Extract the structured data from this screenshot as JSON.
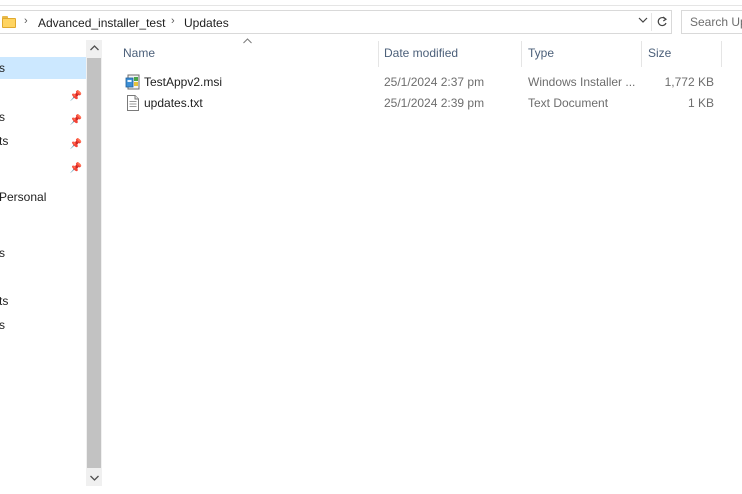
{
  "address": {
    "breadcrumbs": [
      "Advanced_installer_test",
      "Updates"
    ]
  },
  "search": {
    "placeholder": "Search Up"
  },
  "nav": {
    "items": [
      {
        "label": "s",
        "selected": true,
        "pinned": false
      },
      {
        "label": "",
        "selected": false,
        "pinned": true
      },
      {
        "label": "s",
        "selected": false,
        "pinned": true
      },
      {
        "label": "ts",
        "selected": false,
        "pinned": true
      },
      {
        "label": "",
        "selected": false,
        "pinned": true
      },
      {
        "label": "Personal",
        "selected": false,
        "pinned": false
      },
      {
        "label": "s",
        "selected": false,
        "pinned": false
      },
      {
        "label": "ts",
        "selected": false,
        "pinned": false
      },
      {
        "label": "s",
        "selected": false,
        "pinned": false
      }
    ]
  },
  "columns": {
    "name": "Name",
    "date": "Date modified",
    "type": "Type",
    "size": "Size"
  },
  "files": [
    {
      "name": "TestAppv2.msi",
      "date": "25/1/2024 2:37 pm",
      "type": "Windows Installer ...",
      "size": "1,772 KB",
      "icon": "msi-installer-icon"
    },
    {
      "name": "updates.txt",
      "date": "25/1/2024 2:39 pm",
      "type": "Text Document",
      "size": "1 KB",
      "icon": "text-document-icon"
    }
  ],
  "colors": {
    "selection": "#cce8ff",
    "header_text": "#4c607a",
    "folder": "#ffd461"
  }
}
